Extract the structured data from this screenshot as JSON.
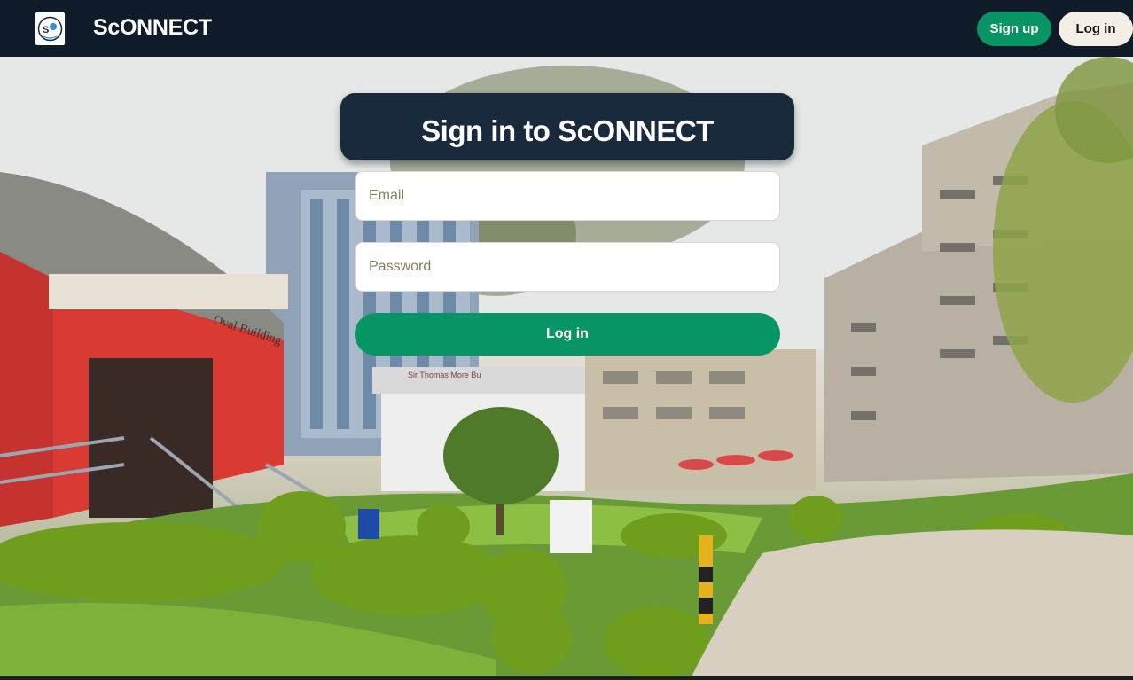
{
  "header": {
    "brand": "ScONNECT",
    "logo_icon": "sconnect-logo-icon",
    "signup_label": "Sign up",
    "login_label": "Log in"
  },
  "hero": {
    "background": "campus-photo",
    "building_sign": "Oval Building",
    "library_sign": "Sir Thomas More Bu"
  },
  "form": {
    "title": "Sign in to ScONNECT",
    "email_placeholder": "Email",
    "password_placeholder": "Password",
    "submit_label": "Log in"
  },
  "colors": {
    "header_bg": "#0f1b29",
    "accent_green": "#079566",
    "panel_bg": "#1a2a3d",
    "light_button": "#f3eee6"
  }
}
